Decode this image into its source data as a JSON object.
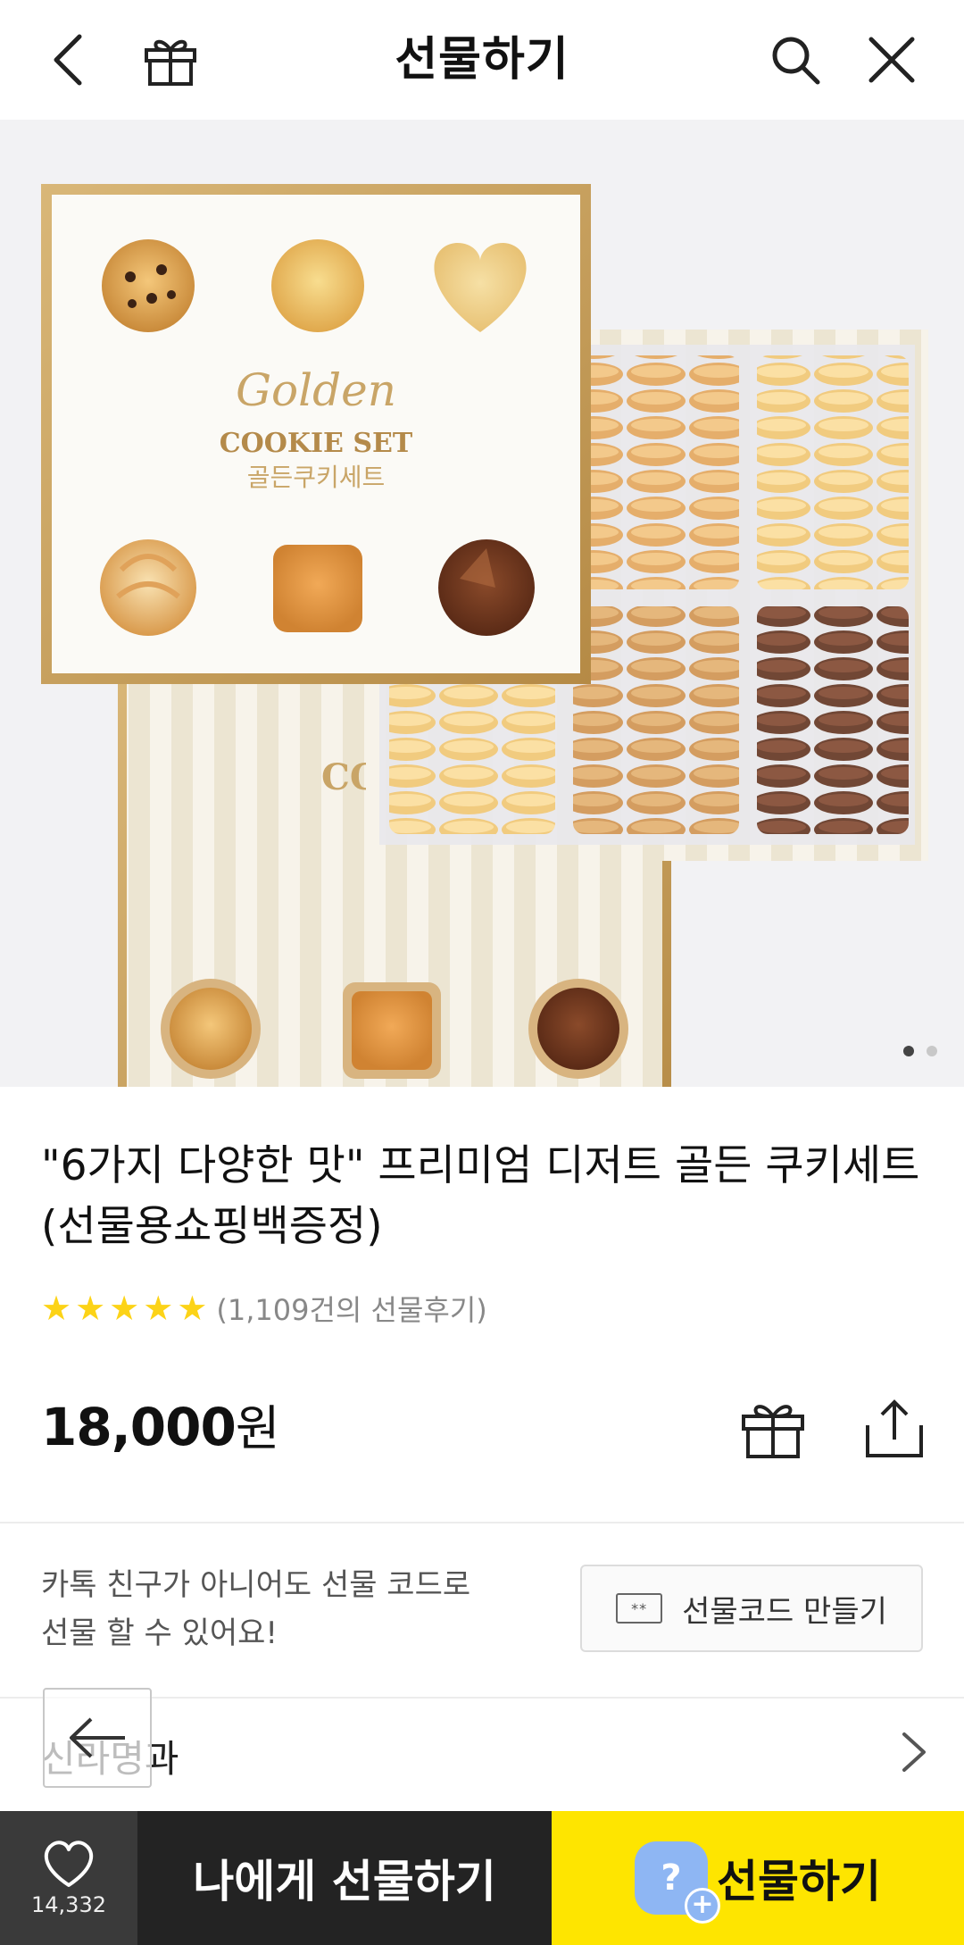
{
  "header": {
    "title": "선물하기",
    "back_icon": "back-arrow-icon",
    "gift_icon": "gift-box-icon",
    "search_icon": "search-icon",
    "close_icon": "close-icon"
  },
  "hero": {
    "box_title_script": "Golden",
    "box_title": "COOKIE SET",
    "box_title_ko": "골든쿠키세트",
    "box_lid_partial": "COO",
    "page_indicator": {
      "total": 2,
      "current": 1
    }
  },
  "product": {
    "name": "\"6가지 다양한 맛\" 프리미엄 디저트 골든 쿠키세트(선물용쇼핑백증정)",
    "rating_stars": 5,
    "review_text": "(1,109건의 선물후기)",
    "price_number": "18,000",
    "price_unit": "원"
  },
  "gift_code": {
    "line1": "카톡 친구가 아니어도 선물 코드로",
    "line2": "선물 할 수 있어요!",
    "button_label": "선물코드 만들기",
    "button_icon_text": "**"
  },
  "section": {
    "label": "신라명과"
  },
  "bottom_bar": {
    "like_count": "14,332",
    "gift_to_me": "나에게 선물하기",
    "gift": "선물하기",
    "bubble_char": "?",
    "plus_char": "+"
  },
  "colors": {
    "accent_yellow": "#fee500",
    "dark_button": "#232323",
    "like_bg": "#3a3a3a",
    "star": "#fcd317"
  }
}
